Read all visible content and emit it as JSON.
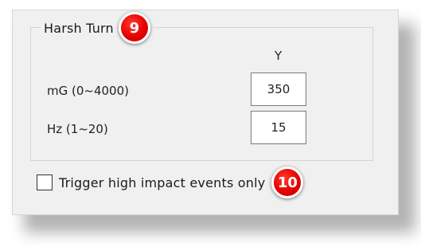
{
  "group": {
    "title": "Harsh Turn",
    "badge": "9",
    "column_header": "Y",
    "rows": [
      {
        "label": "mG (0~4000)",
        "value": "350"
      },
      {
        "label": "Hz (1~20)",
        "value": "15"
      }
    ]
  },
  "options": {
    "trigger_label": "Trigger high impact events only",
    "trigger_checked": false,
    "badge": "10"
  },
  "colors": {
    "badge_red": "#e60000",
    "panel_bg": "#f0f0f0"
  }
}
